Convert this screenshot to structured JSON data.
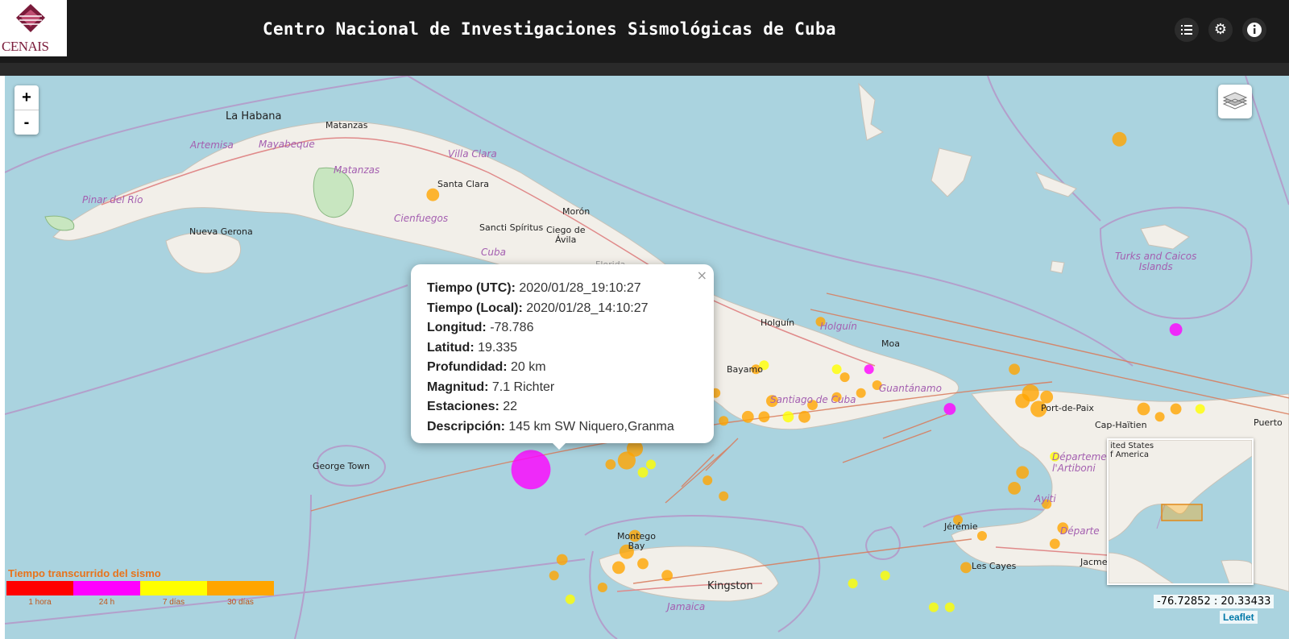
{
  "app": {
    "logo_text": "CENAIS",
    "title": "Centro Nacional de Investigaciones Sismológicas de Cuba"
  },
  "toolbar": {
    "list_icon": "list-icon",
    "settings_icon": "gear-icon",
    "info_icon": "info-icon"
  },
  "map": {
    "zoom_in": "+",
    "zoom_out": "-",
    "places": {
      "la_habana": "La Habana",
      "matanzas_city": "Matanzas",
      "artemisa": "Artemisa",
      "mayabeque": "Mayabeque",
      "villa_clara": "Villa Clara",
      "matanzas_prov": "Matanzas",
      "santa_clara": "Santa Clara",
      "pinar_del_rio": "Pinar del Río",
      "cienfuegos": "Cienfuegos",
      "moron": "Morón",
      "sancti_spiritus": "Sancti Spíritus",
      "ciego_de_avila": "Ciego de\nÁvila",
      "nueva_gerona": "Nueva Gerona",
      "cuba": "Cuba",
      "florida": "Florida",
      "holguin_city": "Holguín",
      "holguin_prov": "Holguín",
      "moa": "Moa",
      "bayamo": "Bayamo",
      "santiago": "Santiago de Cuba",
      "guantanamo": "Guantánamo",
      "turks": "Turks and Caicos\nIslands",
      "port_de_paix": "Port-de-Paix",
      "cap_haitien": "Cap-Haïtien",
      "puerto": "Puerto",
      "departement": "Départeme\nl'Artiboni",
      "george_town": "George Town",
      "montego_bay": "Montego\nBay",
      "kingston": "Kingston",
      "jamaica": "Jamaica",
      "jeremie": "Jérémie",
      "ayiti": "Ayiti",
      "les_cayes": "Les Cayes",
      "jacmel": "Jacmel",
      "departement2": "Départe"
    }
  },
  "popup": {
    "close": "×",
    "rows": [
      {
        "label": "Tiempo (UTC):",
        "value": "2020/01/28_19:10:27"
      },
      {
        "label": "Tiempo (Local):",
        "value": "2020/01/28_14:10:27"
      },
      {
        "label": "Longitud:",
        "value": "-78.786"
      },
      {
        "label": "Latitud:",
        "value": "19.335"
      },
      {
        "label": "Profundidad:",
        "value": "20 km"
      },
      {
        "label": "Magnitud:",
        "value": "7.1 Richter"
      },
      {
        "label": "Estaciones:",
        "value": "22"
      },
      {
        "label": "Descripción:",
        "value": "145 km SW Niquero,Granma"
      }
    ]
  },
  "minimap": {
    "label": "ited States\nf America"
  },
  "coords": "-76.72852 : 20.33433",
  "attribution": "Leaflet",
  "legend": {
    "title": "Tiempo transcurrido del sismo",
    "items": [
      {
        "label": "1 hora",
        "color": "#ff0000"
      },
      {
        "label": "24 h",
        "color": "#ff00ff"
      },
      {
        "label": "7 días",
        "color": "#ffff00"
      },
      {
        "label": "30 días",
        "color": "#ffa500"
      }
    ]
  },
  "colors": {
    "sea": "#aad3df",
    "land": "#f2efe9",
    "boundary": "#b596c8",
    "fault": "#e07050",
    "orange": "#ffa500",
    "yellow": "#ffff00",
    "magenta": "#ff00ff"
  },
  "events": [
    {
      "lon": -78.786,
      "lat": 19.335,
      "mag": 7.1,
      "age": "24 h"
    },
    {
      "lon": -80.0,
      "lat": 22.8,
      "mag": 4.0,
      "age": "30 días"
    },
    {
      "lon": -71.5,
      "lat": 23.5,
      "mag": 4.2,
      "age": "30 días"
    },
    {
      "lon": -70.8,
      "lat": 21.1,
      "mag": 4.0,
      "age": "24 h"
    },
    {
      "lon": -72.8,
      "lat": 20.6,
      "mag": 3.8,
      "age": "30 días"
    },
    {
      "lon": -73.6,
      "lat": 20.1,
      "mag": 3.9,
      "age": "24 h"
    },
    {
      "lon": -72.7,
      "lat": 20.2,
      "mag": 4.2,
      "age": "30 días"
    },
    {
      "lon": -72.6,
      "lat": 20.3,
      "mag": 4.5,
      "age": "30 días"
    },
    {
      "lon": -72.5,
      "lat": 20.1,
      "mag": 4.4,
      "age": "30 días"
    },
    {
      "lon": -72.4,
      "lat": 20.25,
      "mag": 4.0,
      "age": "30 días"
    },
    {
      "lon": -71.2,
      "lat": 20.1,
      "mag": 4.0,
      "age": "30 días"
    },
    {
      "lon": -70.8,
      "lat": 20.1,
      "mag": 3.8,
      "age": "30 días"
    },
    {
      "lon": -72.7,
      "lat": 19.3,
      "mag": 4.0,
      "age": "30 días"
    },
    {
      "lon": -72.8,
      "lat": 19.1,
      "mag": 4.0,
      "age": "30 días"
    },
    {
      "lon": -72.3,
      "lat": 19.5,
      "mag": 3.6,
      "age": "7 días"
    },
    {
      "lon": -72.4,
      "lat": 18.9,
      "mag": 3.5,
      "age": "30 días"
    },
    {
      "lon": -72.2,
      "lat": 18.6,
      "mag": 3.8,
      "age": "30 días"
    },
    {
      "lon": -73.5,
      "lat": 18.7,
      "mag": 3.6,
      "age": "30 días"
    },
    {
      "lon": -73.2,
      "lat": 18.5,
      "mag": 3.6,
      "age": "30 días"
    },
    {
      "lon": -72.3,
      "lat": 18.4,
      "mag": 3.7,
      "age": "30 días"
    },
    {
      "lon": -73.4,
      "lat": 18.1,
      "mag": 3.8,
      "age": "30 días"
    },
    {
      "lon": -74.4,
      "lat": 18.0,
      "mag": 3.5,
      "age": "7 días"
    },
    {
      "lon": -73.8,
      "lat": 17.6,
      "mag": 3.6,
      "age": "7 días"
    },
    {
      "lon": -75.2,
      "lat": 21.2,
      "mag": 3.5,
      "age": "30 días"
    },
    {
      "lon": -75.0,
      "lat": 20.6,
      "mag": 3.6,
      "age": "7 días"
    },
    {
      "lon": -74.9,
      "lat": 20.5,
      "mag": 3.4,
      "age": "30 días"
    },
    {
      "lon": -75.4,
      "lat": 20.0,
      "mag": 3.9,
      "age": "30 días"
    },
    {
      "lon": -75.6,
      "lat": 20.0,
      "mag": 3.8,
      "age": "7 días"
    },
    {
      "lon": -75.9,
      "lat": 20.0,
      "mag": 3.8,
      "age": "30 días"
    },
    {
      "lon": -76.1,
      "lat": 20.0,
      "mag": 3.9,
      "age": "30 días"
    },
    {
      "lon": -76.4,
      "lat": 19.95,
      "mag": 3.6,
      "age": "30 días"
    },
    {
      "lon": -76.7,
      "lat": 20.0,
      "mag": 4.0,
      "age": "30 días"
    },
    {
      "lon": -77.0,
      "lat": 19.95,
      "mag": 3.8,
      "age": "30 días"
    },
    {
      "lon": -77.3,
      "lat": 19.9,
      "mag": 3.8,
      "age": "30 días"
    },
    {
      "lon": -76.5,
      "lat": 20.3,
      "mag": 3.4,
      "age": "30 días"
    },
    {
      "lon": -76.8,
      "lat": 20.4,
      "mag": 3.5,
      "age": "30 días"
    },
    {
      "lon": -77.0,
      "lat": 20.3,
      "mag": 3.5,
      "age": "7 días"
    },
    {
      "lon": -76.9,
      "lat": 20.8,
      "mag": 3.6,
      "age": "30 días"
    },
    {
      "lon": -77.5,
      "lat": 19.6,
      "mag": 4.4,
      "age": "30 días"
    },
    {
      "lon": -77.6,
      "lat": 19.45,
      "mag": 4.6,
      "age": "30 días"
    },
    {
      "lon": -77.4,
      "lat": 19.3,
      "mag": 3.7,
      "age": "7 días"
    },
    {
      "lon": -77.3,
      "lat": 19.4,
      "mag": 3.6,
      "age": "7 días"
    },
    {
      "lon": -77.8,
      "lat": 19.4,
      "mag": 3.7,
      "age": "30 días"
    },
    {
      "lon": -76.6,
      "lat": 19.2,
      "mag": 3.4,
      "age": "30 días"
    },
    {
      "lon": -76.4,
      "lat": 19.0,
      "mag": 3.4,
      "age": "30 días"
    },
    {
      "lon": -77.5,
      "lat": 18.5,
      "mag": 3.9,
      "age": "30 días"
    },
    {
      "lon": -77.6,
      "lat": 18.3,
      "mag": 4.2,
      "age": "30 días"
    },
    {
      "lon": -77.4,
      "lat": 18.15,
      "mag": 3.8,
      "age": "30 días"
    },
    {
      "lon": -77.7,
      "lat": 18.1,
      "mag": 4.0,
      "age": "30 días"
    },
    {
      "lon": -77.1,
      "lat": 18.0,
      "mag": 3.8,
      "age": "30 días"
    },
    {
      "lon": -78.4,
      "lat": 18.2,
      "mag": 3.8,
      "age": "30 días"
    },
    {
      "lon": -78.5,
      "lat": 18.0,
      "mag": 3.6,
      "age": "30 días"
    },
    {
      "lon": -77.9,
      "lat": 17.85,
      "mag": 3.6,
      "age": "30 días"
    },
    {
      "lon": -78.3,
      "lat": 17.7,
      "mag": 3.6,
      "age": "7 días"
    },
    {
      "lon": -74.8,
      "lat": 17.9,
      "mag": 3.4,
      "age": "7 días"
    },
    {
      "lon": -73.6,
      "lat": 17.6,
      "mag": 3.4,
      "age": "7 días"
    },
    {
      "lon": -76.7,
      "lat": 21.3,
      "mag": 3.4,
      "age": "30 días"
    },
    {
      "lon": -76.0,
      "lat": 20.6,
      "mag": 3.4,
      "age": "30 días"
    },
    {
      "lon": -75.8,
      "lat": 20.2,
      "mag": 3.9,
      "age": "30 días"
    },
    {
      "lon": -75.3,
      "lat": 20.15,
      "mag": 3.7,
      "age": "30 días"
    },
    {
      "lon": -75.0,
      "lat": 20.25,
      "mag": 3.6,
      "age": "30 días"
    },
    {
      "lon": -74.7,
      "lat": 20.3,
      "mag": 3.4,
      "age": "30 días"
    },
    {
      "lon": -74.5,
      "lat": 20.4,
      "mag": 3.3,
      "age": "30 días"
    },
    {
      "lon": -74.6,
      "lat": 20.6,
      "mag": 3.4,
      "age": "24 h"
    },
    {
      "lon": -75.9,
      "lat": 20.65,
      "mag": 3.4,
      "age": "7 días"
    },
    {
      "lon": -71.0,
      "lat": 20.0,
      "mag": 3.5,
      "age": "30 días"
    },
    {
      "lon": -70.5,
      "lat": 20.1,
      "mag": 3.4,
      "age": "7 días"
    }
  ]
}
